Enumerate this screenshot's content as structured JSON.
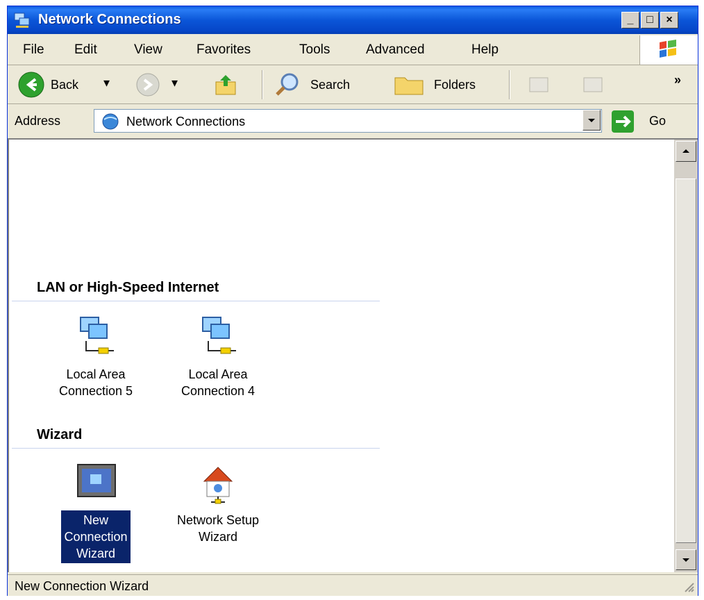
{
  "window": {
    "title": "Network Connections"
  },
  "title_buttons": {
    "minimize": "_",
    "maximize": "□",
    "close": "×"
  },
  "menu": {
    "items": [
      "File",
      "Edit",
      "View",
      "Favorites",
      "Tools",
      "Advanced",
      "Help"
    ]
  },
  "toolbar": {
    "back_label": "Back",
    "search_label": "Search",
    "folders_label": "Folders",
    "overflow": "»"
  },
  "address": {
    "label": "Address",
    "value": "Network Connections",
    "go_label": "Go"
  },
  "groups": [
    {
      "title": "LAN or High-Speed Internet",
      "items": [
        {
          "line1": "Local Area",
          "line2": "Connection 5",
          "icon": "lan-connection-icon"
        },
        {
          "line1": "Local Area",
          "line2": "Connection 4",
          "icon": "lan-connection-icon"
        }
      ]
    },
    {
      "title": "Wizard",
      "items": [
        {
          "line1": "New",
          "line2": "Connection",
          "line3": "Wizard",
          "icon": "new-connection-wizard-icon",
          "selected": true
        },
        {
          "line1": "Network Setup",
          "line2": "Wizard",
          "icon": "network-setup-wizard-icon"
        }
      ]
    }
  ],
  "status": {
    "text": "New Connection Wizard"
  },
  "colors": {
    "titlebar": "#0b56d8",
    "selection": "#0a246a",
    "chrome": "#ece9d8"
  }
}
